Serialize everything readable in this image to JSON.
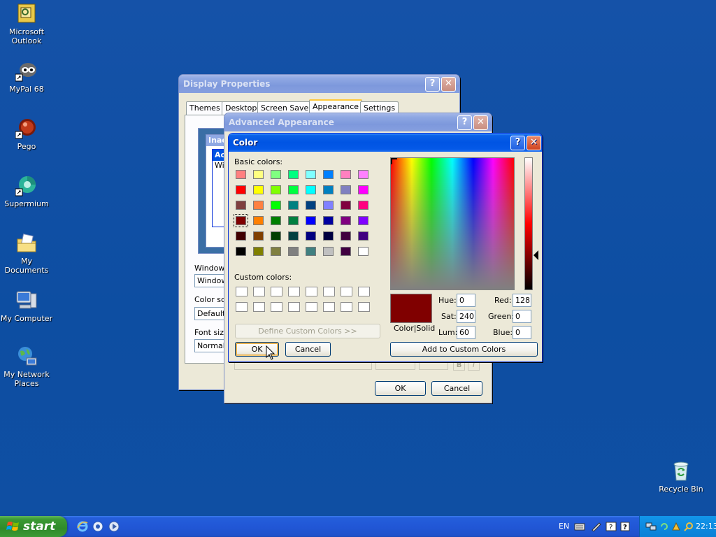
{
  "desktop_icons": [
    {
      "label": "Microsoft Outlook",
      "icon": "outlook-icon"
    },
    {
      "label": "MyPal 68",
      "icon": "mypal-icon"
    },
    {
      "label": "Pego",
      "icon": "pego-icon"
    },
    {
      "label": "Supermium",
      "icon": "supermium-icon"
    },
    {
      "label": "My Documents",
      "icon": "documents-icon"
    },
    {
      "label": "My Computer",
      "icon": "computer-icon"
    },
    {
      "label": "My Network Places",
      "icon": "network-icon"
    },
    {
      "label": "Recycle Bin",
      "icon": "recycle-bin-icon"
    }
  ],
  "display_properties": {
    "title": "Display Properties",
    "tabs": [
      "Themes",
      "Desktop",
      "Screen Saver",
      "Appearance",
      "Settings"
    ],
    "selected_tab": "Appearance",
    "preview_inactive": "Inac",
    "preview_active": "Ac",
    "preview_text": "Win",
    "windows_label": "Windows",
    "windows_value": "Window",
    "color_scheme_label": "Color sch",
    "color_scheme_value": "Default",
    "font_size_label": "Font size",
    "font_size_value": "Normal"
  },
  "advanced_appearance": {
    "title": "Advanced Appearance",
    "ok": "OK",
    "cancel": "Cancel"
  },
  "color_dialog": {
    "title": "Color",
    "basic_colors_label": "Basic colors:",
    "custom_colors_label": "Custom colors:",
    "define_custom": "Define Custom Colors >>",
    "ok": "OK",
    "cancel": "Cancel",
    "color_solid_label": "Color|Solid",
    "hue_label": "Hue:",
    "hue": "0",
    "sat_label": "Sat:",
    "sat": "240",
    "lum_label": "Lum:",
    "lum": "60",
    "red_label": "Red:",
    "red": "128",
    "green_label": "Green:",
    "green": "0",
    "blue_label": "Blue:",
    "blue": "0",
    "add_custom": "Add to Custom Colors",
    "selected_color": "#800000",
    "basic_colors": [
      [
        "#ff8080",
        "#ffff80",
        "#80ff80",
        "#00ff80",
        "#80ffff",
        "#0080ff",
        "#ff80c0",
        "#ff80ff"
      ],
      [
        "#ff0000",
        "#ffff00",
        "#80ff00",
        "#00ff40",
        "#00ffff",
        "#0080c0",
        "#8080c0",
        "#ff00ff"
      ],
      [
        "#804040",
        "#ff8040",
        "#00ff00",
        "#008080",
        "#004080",
        "#8080ff",
        "#800040",
        "#ff0080"
      ],
      [
        "#800000",
        "#ff8000",
        "#008000",
        "#008040",
        "#0000ff",
        "#0000a0",
        "#800080",
        "#8000ff"
      ],
      [
        "#400000",
        "#804000",
        "#004000",
        "#004040",
        "#000080",
        "#000040",
        "#400040",
        "#400080"
      ],
      [
        "#000000",
        "#808000",
        "#808040",
        "#808080",
        "#408080",
        "#c0c0c0",
        "#400040",
        "#ffffff"
      ]
    ]
  },
  "taskbar": {
    "start_label": "start",
    "language": "EN",
    "clock": "22:13"
  }
}
